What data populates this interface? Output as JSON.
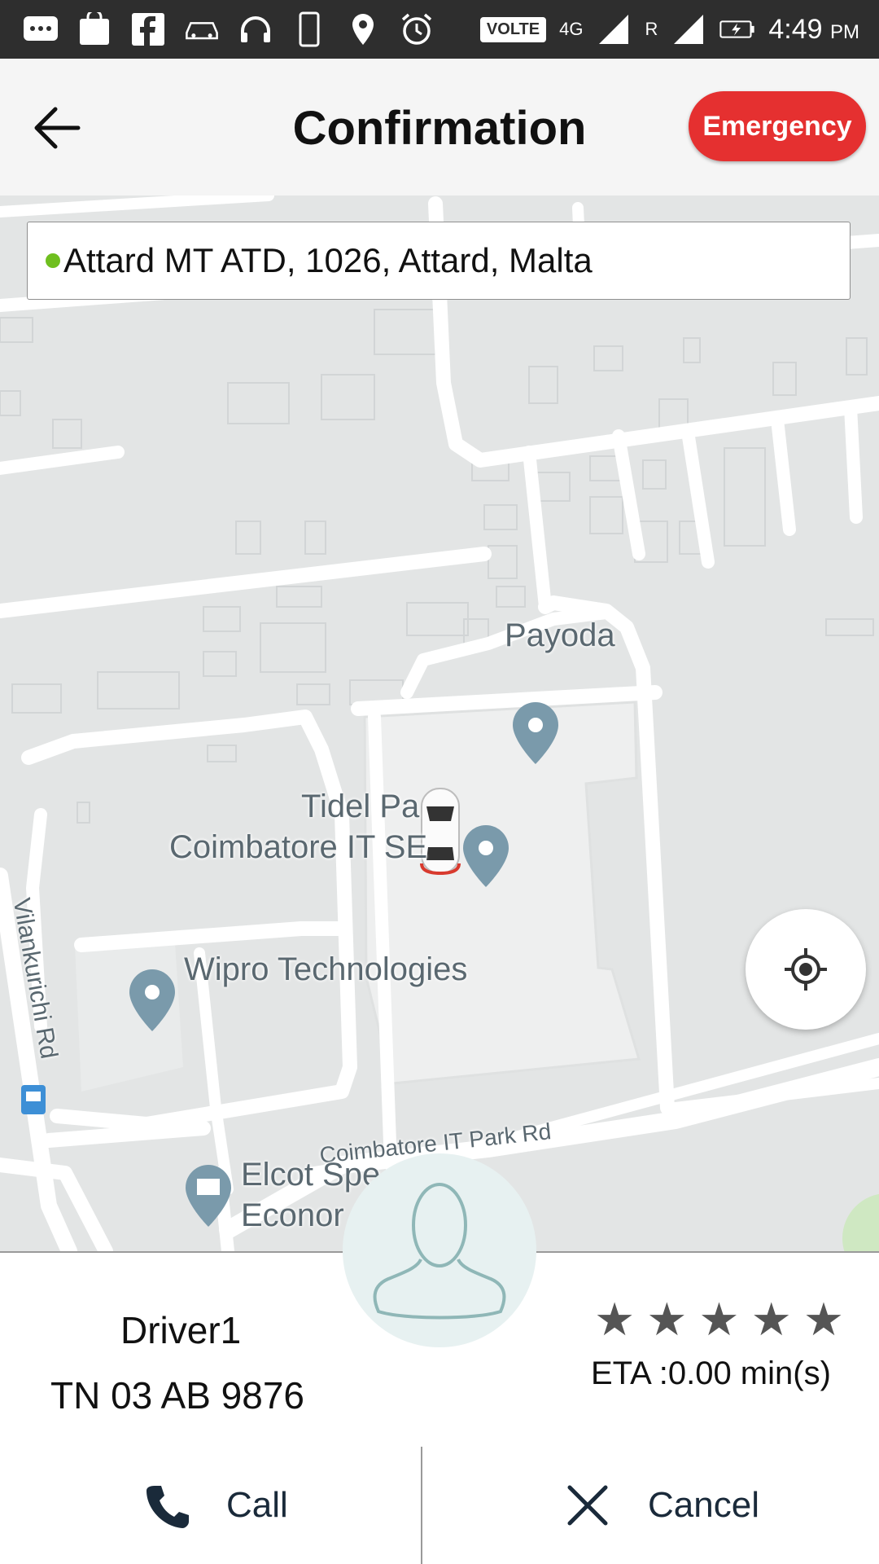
{
  "status_bar": {
    "time": "4:49",
    "ampm": "PM",
    "network_label": "VOLTE",
    "network_type": "4G",
    "roaming": "R"
  },
  "header": {
    "title": "Confirmation",
    "emergency_label": "Emergency"
  },
  "address": {
    "text": "Attard MT ATD, 1026, Attard, Malta"
  },
  "map": {
    "labels": {
      "payoda": "Payoda",
      "tidel_1": "Tidel Pa",
      "tidel_2": "Coimbatore IT SE",
      "wipro": "Wipro Technologies",
      "vilankurichi": "Vilankurichi Rd",
      "it_park_rd": "Coimbatore IT Park Rd",
      "elcot_1": "Elcot Spe",
      "elcot_2": "Econor"
    }
  },
  "driver": {
    "name": "Driver1",
    "plate": "TN 03 AB 9876",
    "rating": 5,
    "eta": "ETA :0.00 min(s)"
  },
  "actions": {
    "call_label": "Call",
    "cancel_label": "Cancel"
  },
  "colors": {
    "emergency": "#e53030",
    "status_bar": "#2e2e2e",
    "pin": "#7a9aab",
    "address_dot": "#6fbf1f"
  }
}
